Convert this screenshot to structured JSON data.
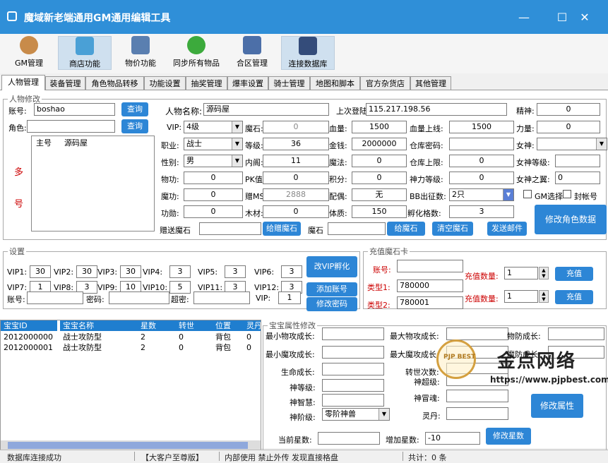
{
  "window": {
    "title": "魔域新老端通用GM通用编辑工具",
    "min": "—",
    "max": "☐",
    "close": "✕"
  },
  "toolbar": [
    {
      "label": "GM管理",
      "icon": "gm-user-icon"
    },
    {
      "label": "商店功能",
      "icon": "shop-icon"
    },
    {
      "label": "物价功能",
      "icon": "price-server-icon"
    },
    {
      "label": "同步所有物品",
      "icon": "sync-icon"
    },
    {
      "label": "合区管理",
      "icon": "merge-server-icon"
    },
    {
      "label": "连接数据库",
      "icon": "database-icon"
    }
  ],
  "tabs": [
    "人物管理",
    "装备管理",
    "角色物品转移",
    "功能设置",
    "抽奖管理",
    "爆率设置",
    "骑士管理",
    "地图和脚本",
    "官方杂货店",
    "其他管理"
  ],
  "char": {
    "legend": "人物修改",
    "account_label": "账号:",
    "account": "boshao",
    "query": "查询",
    "role_label": "角色:",
    "role": "",
    "duo": "多",
    "hao": "号",
    "list_cols": [
      "主号",
      "源码屋"
    ],
    "name_label": "人物名称:",
    "name": "源码屋",
    "lastip_label": "上次登陆IP:",
    "lastip": "115.217.198.56",
    "spirit_label": "精神:",
    "spirit": "0",
    "vip_label": "VIP:",
    "vip": "4级",
    "moshi_label": "魔石:",
    "moshi": "0",
    "hp_label": "血量:",
    "hp": "1500",
    "hpmax_label": "血量上线:",
    "hpmax": "1500",
    "power_label": "力量:",
    "power": "0",
    "job_label": "职业:",
    "job": "战士",
    "level_label": "等级:",
    "level": "36",
    "gold_label": "金钱:",
    "gold": "2000000",
    "whpwd_label": "仓库密码:",
    "whpwd": "",
    "nvshen_label": "女神:",
    "nvshen": "",
    "sex_label": "性别:",
    "sex": "男",
    "neijin_label": "内阁:",
    "neijin": "11",
    "mofa_label": "魔法:",
    "mofa": "0",
    "whmax_label": "仓库上限:",
    "whmax": "0",
    "nslv_label": "女神等级:",
    "nslv": "",
    "wugong_label": "物功:",
    "wugong": "0",
    "pk_label": "PK值:",
    "pk": "0",
    "jifen_label": "积分:",
    "jifen": "0",
    "shenli_label": "神力等级:",
    "shenli": "0",
    "nszy_label": "女神之翼:",
    "nszy": "0",
    "mogong_label": "魔功:",
    "mogong": "0",
    "zms_label": "赠MS:",
    "zms": "2888",
    "peiou_label": "配偶:",
    "peiou": "无",
    "bb_label": "BB出征数:",
    "bb": "2只",
    "gm_select": "GM选择",
    "fenghao": "封帐号",
    "gongxun_label": "功勋:",
    "gongxun": "0",
    "mucai_label": "木材:",
    "mucai": "0",
    "tizhi_label": "体质:",
    "tizhi": "150",
    "fuhua_label": "孵化格数:",
    "fuhua": "3",
    "modify": "修改角色数据",
    "zsms_label": "赠送魔石",
    "zsms_btn": "给赠魔石",
    "ms_label": "魔石",
    "gms_btn": "给魔石",
    "clear_btn": "清空魔石",
    "mail_btn": "发送邮件"
  },
  "settings": {
    "legend": "设置",
    "vips": [
      {
        "l": "VIP1:",
        "v": "30"
      },
      {
        "l": "VIP2:",
        "v": "30"
      },
      {
        "l": "VIP3:",
        "v": "30"
      },
      {
        "l": "VIP4:",
        "v": "3"
      },
      {
        "l": "VIP5:",
        "v": "3"
      },
      {
        "l": "VIP6:",
        "v": "3"
      },
      {
        "l": "VIP7:",
        "v": "1"
      },
      {
        "l": "VIP8:",
        "v": "3"
      },
      {
        "l": "VIP9:",
        "v": "10"
      },
      {
        "l": "VIP10:",
        "v": "5"
      },
      {
        "l": "VIP11:",
        "v": "3"
      },
      {
        "l": "VIP12:",
        "v": "3"
      }
    ],
    "acct_label": "账号:",
    "pwd_label": "密码:",
    "superpwd_label": "超密:",
    "vip_label": "VIP:",
    "vip": "1",
    "btn_vip": "改VIP孵化",
    "btn_add": "添加账号",
    "btn_pwd": "修改密码"
  },
  "card": {
    "legend": "充值魔石卡",
    "acct_label": "账号:",
    "type1_label": "类型1:",
    "type1": "780000",
    "type2_label": "类型2:",
    "type2": "780001",
    "qty_label": "充值数量:",
    "qty1": "1",
    "qty2": "1",
    "btn": "充值"
  },
  "pets": {
    "cols": [
      "宝宝ID",
      "宝宝名称",
      "星数",
      "转世",
      "位置",
      "灵丹"
    ],
    "rows": [
      [
        "2012000000",
        "战士攻防型",
        "2",
        "0",
        "背包",
        "0"
      ],
      [
        "2012000001",
        "战士攻防型",
        "2",
        "0",
        "背包",
        "0"
      ]
    ]
  },
  "petattr": {
    "legend": "宝宝属性修改",
    "min_phy": "最小物攻成长:",
    "max_phy": "最大物攻成长:",
    "phy_def": "物防成长:",
    "min_mag": "最小魔攻成长:",
    "max_mag": "最大魔攻成长:",
    "mag_def": "魔防成长:",
    "life": "生命成长:",
    "reinc": "转世次数:",
    "shen_lv": "神等级:",
    "shen_chao": "神超级:",
    "shen_zhi": "神智慧:",
    "shen_hun": "神冒魂:",
    "shen_jie": "神阶级:",
    "shen_jie_val": "零阶神兽",
    "lingdan": "灵丹:",
    "btn_attr": "修改属性",
    "cur_star": "当前星数:",
    "add_star": "增加星数:",
    "add_star_val": "-10",
    "btn_star": "修改星数"
  },
  "status": {
    "s1": "数据库连接成功",
    "s2": "【大客户至尊版】",
    "s3": "内部使用 禁止外传 发现直接格盘",
    "s4": "共计：0 条"
  },
  "watermark": {
    "cn": "金点网络",
    "url": "https://www.pjpbest.com",
    "badge": "PJP BEST"
  },
  "colors": {
    "titlebar": "#2f8fd8",
    "button": "#2d86d6",
    "grid_header": "#1f7ecf"
  }
}
